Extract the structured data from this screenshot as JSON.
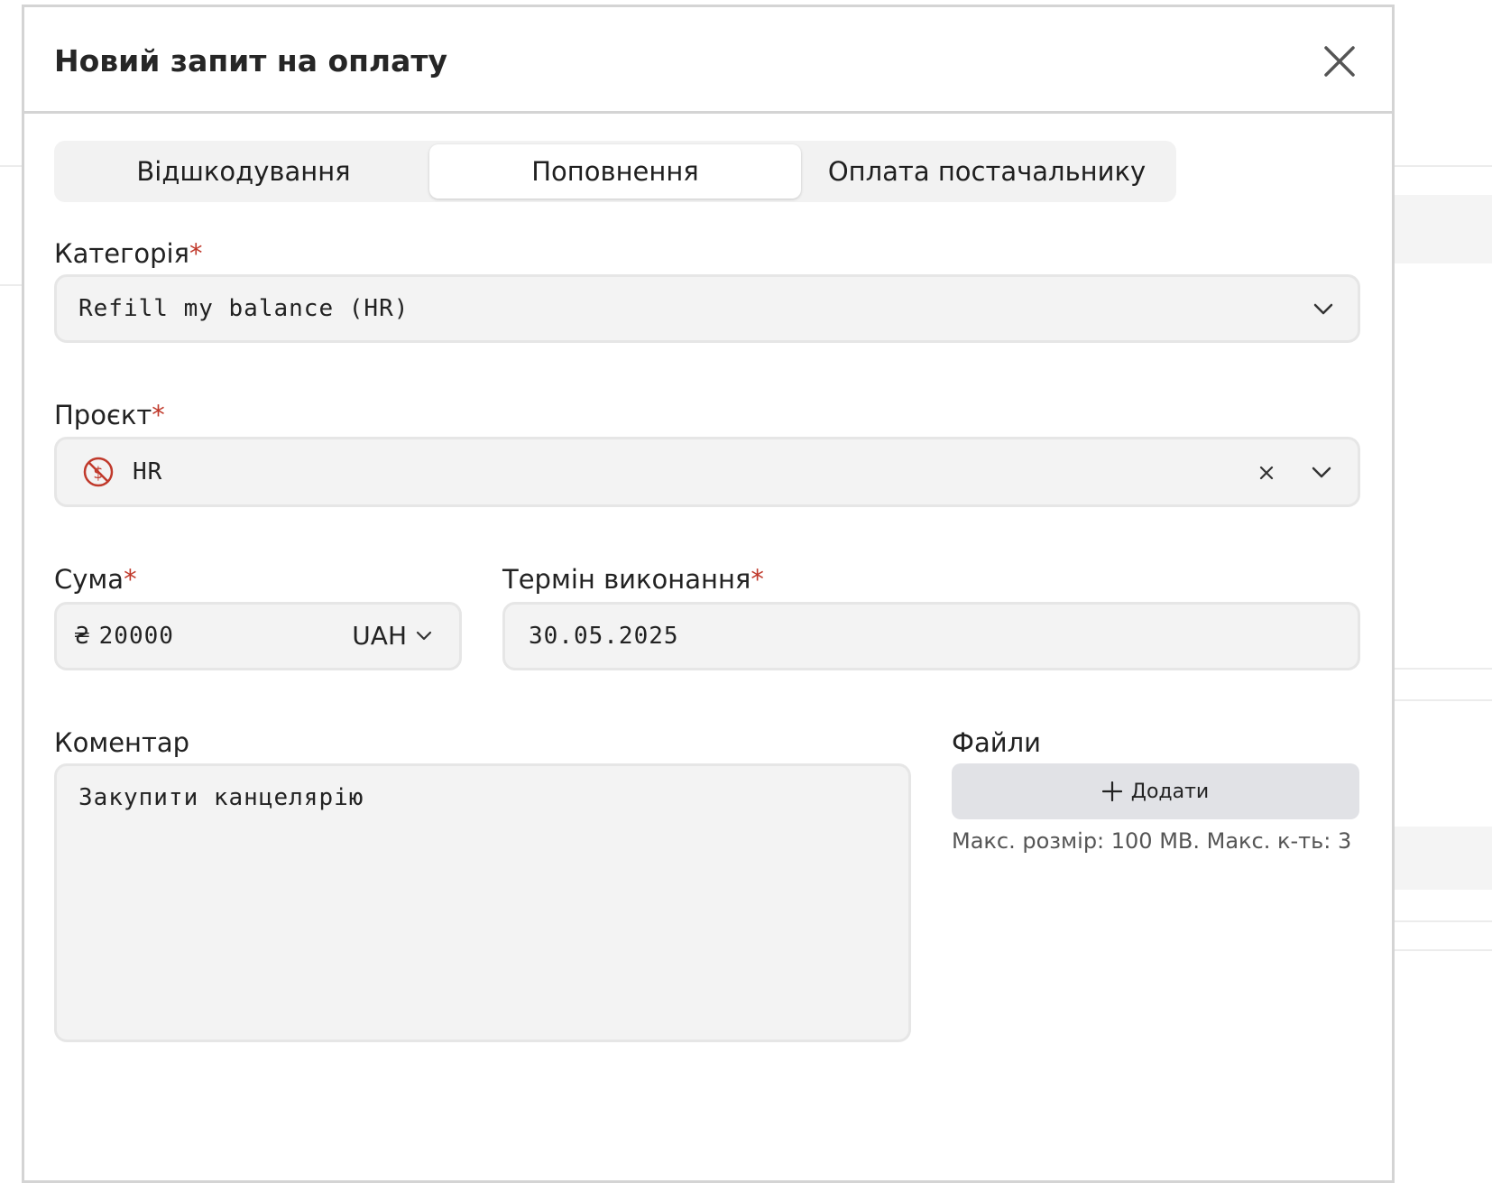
{
  "modal": {
    "title": "Новий запит на оплату"
  },
  "tabs": [
    {
      "label": "Відшкодування",
      "active": false
    },
    {
      "label": "Поповнення",
      "active": true
    },
    {
      "label": "Оплата постачальнику",
      "active": false
    }
  ],
  "form": {
    "category": {
      "label": "Категорія",
      "required_mark": "*",
      "value": "Refill my balance (HR)"
    },
    "project": {
      "label": "Проєкт",
      "required_mark": "*",
      "value": "HR",
      "icon": "no-money-icon",
      "icon_color": "#c0392b"
    },
    "amount": {
      "label": "Сума",
      "required_mark": "*",
      "currency_symbol": "₴",
      "value": "20000",
      "currency": "UAH"
    },
    "deadline": {
      "label": "Термін виконання",
      "required_mark": "*",
      "value": "30.05.2025"
    },
    "comment": {
      "label": "Коментар",
      "value": "Закупити канцелярію"
    },
    "files": {
      "label": "Файли",
      "add_label": "Додати",
      "hint": "Макс. розмір: 100 MB. Макс. к-ть: 3"
    }
  },
  "colors": {
    "required": "#c0392b",
    "add_button_bg": "#e1e2e6",
    "field_bg": "#f3f3f3"
  }
}
